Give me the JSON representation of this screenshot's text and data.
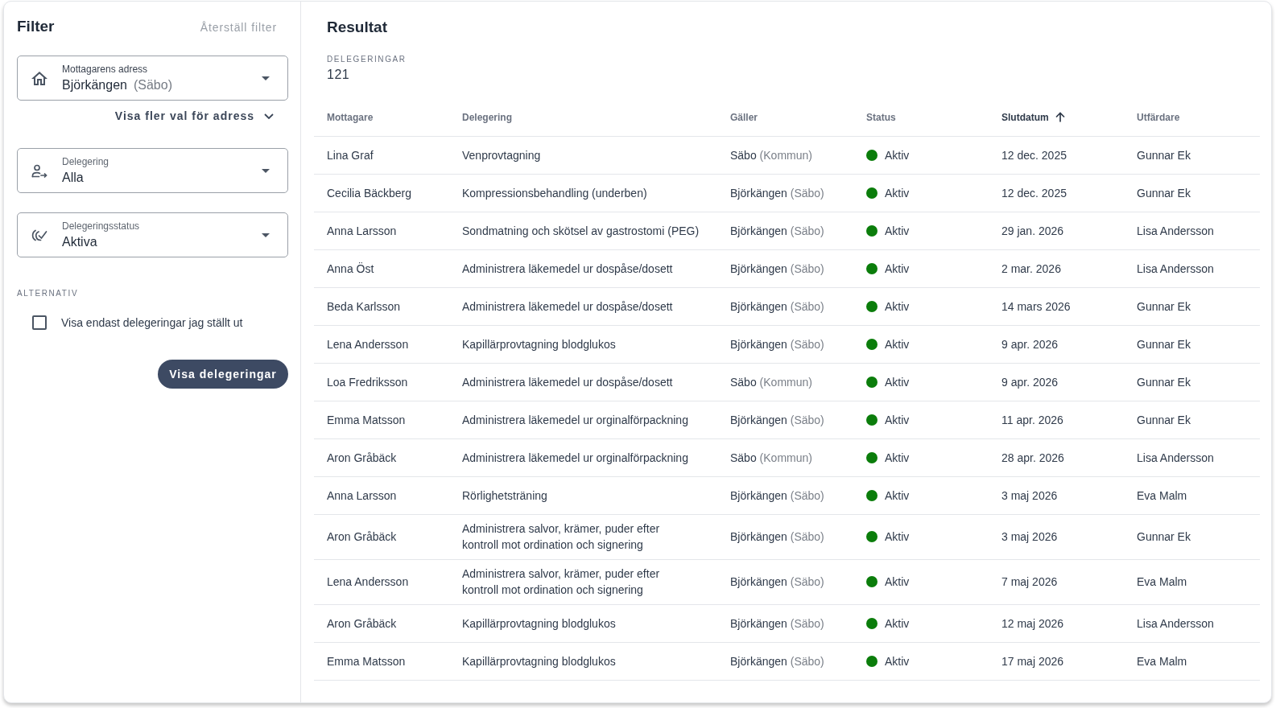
{
  "filter": {
    "title": "Filter",
    "reset_link": "Återställ filter",
    "fields": [
      {
        "kind": "address",
        "label": "Mottagarens adress",
        "value": "Björkängen",
        "value_note": "(Säbo)",
        "more_link": "Visa fler val för adress"
      },
      {
        "kind": "delegation",
        "label": "Delegering",
        "value": "Alla"
      },
      {
        "kind": "status",
        "label": "Delegeringsstatus",
        "value": "Aktiva"
      }
    ],
    "options_heading": "ALTERNATIV",
    "options": [
      {
        "label": "Visa endast delegeringar jag ställt ut",
        "checked": false
      }
    ],
    "submit_button": "Visa delegeringar"
  },
  "results": {
    "title": "Resultat",
    "count_label": "DELEGERINGAR",
    "count": "121",
    "table": {
      "columns": [
        {
          "label": "Mottagare",
          "sorted": false
        },
        {
          "label": "Delegering",
          "sorted": false
        },
        {
          "label": "Gäller",
          "sorted": false
        },
        {
          "label": "Status",
          "sorted": false
        },
        {
          "label": "Slutdatum",
          "sorted": true
        },
        {
          "label": "Utfärdare",
          "sorted": false
        }
      ],
      "rows": [
        {
          "recipient": "Lina Graf",
          "delegation": "Venprovtagning",
          "place": "Säbo",
          "place_note": "(Kommun)",
          "status": "Aktiv",
          "color": "#0b7d0b",
          "end_date": "12 dec. 2025",
          "issuer": "Gunnar Ek"
        },
        {
          "recipient": "Cecilia Bäckberg",
          "delegation": "Kompressionsbehandling (underben)",
          "place": "Björkängen",
          "place_note": "(Säbo)",
          "status": "Aktiv",
          "color": "#0b7d0b",
          "end_date": "12 dec. 2025",
          "issuer": "Gunnar Ek"
        },
        {
          "recipient": "Anna Larsson",
          "delegation": "Sondmatning och skötsel av gastrostomi (PEG)",
          "place": "Björkängen",
          "place_note": "(Säbo)",
          "status": "Aktiv",
          "color": "#0b7d0b",
          "end_date": "29 jan. 2026",
          "issuer": "Lisa Andersson"
        },
        {
          "recipient": "Anna Öst",
          "delegation": "Administrera läkemedel ur dospåse/dosett",
          "place": "Björkängen",
          "place_note": "(Säbo)",
          "status": "Aktiv",
          "color": "#0b7d0b",
          "end_date": "2 mar. 2026",
          "issuer": "Lisa Andersson"
        },
        {
          "recipient": "Beda Karlsson",
          "delegation": "Administrera läkemedel ur dospåse/dosett",
          "place": "Björkängen",
          "place_note": "(Säbo)",
          "status": "Aktiv",
          "color": "#0b7d0b",
          "end_date": "14 mars 2026",
          "issuer": "Gunnar Ek"
        },
        {
          "recipient": "Lena Andersson",
          "delegation": "Kapillärprovtagning blodglukos",
          "place": "Björkängen",
          "place_note": "(Säbo)",
          "status": "Aktiv",
          "color": "#0b7d0b",
          "end_date": "9 apr. 2026",
          "issuer": "Gunnar Ek"
        },
        {
          "recipient": "Loa Fredriksson",
          "delegation": "Administrera läkemedel ur dospåse/dosett",
          "place": "Säbo",
          "place_note": "(Kommun)",
          "status": "Aktiv",
          "color": "#0b7d0b",
          "end_date": "9 apr. 2026",
          "issuer": "Gunnar Ek"
        },
        {
          "recipient": "Emma Matsson",
          "delegation": "Administrera läkemedel ur orginalförpackning",
          "place": "Björkängen",
          "place_note": "(Säbo)",
          "status": "Aktiv",
          "color": "#0b7d0b",
          "end_date": "11 apr. 2026",
          "issuer": "Gunnar Ek"
        },
        {
          "recipient": "Aron Gråbäck",
          "delegation": "Administrera läkemedel ur orginalförpackning",
          "place": "Säbo",
          "place_note": "(Kommun)",
          "status": "Aktiv",
          "color": "#0b7d0b",
          "end_date": "28 apr. 2026",
          "issuer": "Lisa Andersson"
        },
        {
          "recipient": "Anna Larsson",
          "delegation": "Rörlighetsträning",
          "place": "Björkängen",
          "place_note": "(Säbo)",
          "status": "Aktiv",
          "color": "#0b7d0b",
          "end_date": "3 maj 2026",
          "issuer": "Eva Malm"
        },
        {
          "recipient": "Aron Gråbäck",
          "delegation": "Administrera salvor, krämer, puder efter\nkontroll mot ordination och signering",
          "place": "Björkängen",
          "place_note": "(Säbo)",
          "status": "Aktiv",
          "color": "#0b7d0b",
          "end_date": "3 maj 2026",
          "issuer": "Gunnar Ek"
        },
        {
          "recipient": "Lena Andersson",
          "delegation": "Administrera salvor, krämer, puder efter\nkontroll mot ordination och signering",
          "place": "Björkängen",
          "place_note": "(Säbo)",
          "status": "Aktiv",
          "color": "#0b7d0b",
          "end_date": "7 maj 2026",
          "issuer": "Eva Malm"
        },
        {
          "recipient": "Aron Gråbäck",
          "delegation": "Kapillärprovtagning blodglukos",
          "place": "Björkängen",
          "place_note": "(Säbo)",
          "status": "Aktiv",
          "color": "#0b7d0b",
          "end_date": "12 maj 2026",
          "issuer": "Lisa Andersson"
        },
        {
          "recipient": "Emma Matsson",
          "delegation": "Kapillärprovtagning blodglukos",
          "place": "Björkängen",
          "place_note": "(Säbo)",
          "status": "Aktiv",
          "color": "#0b7d0b",
          "end_date": "17 maj 2026",
          "issuer": "Eva Malm"
        }
      ]
    }
  }
}
